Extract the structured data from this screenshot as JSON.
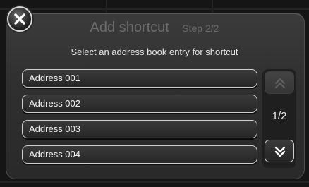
{
  "dialog": {
    "title": "Add shortcut",
    "step": "Step 2/2",
    "instruction": "Select an address book entry for shortcut",
    "close_icon": "close-icon"
  },
  "entries": [
    {
      "label": "Address 001"
    },
    {
      "label": "Address 002"
    },
    {
      "label": "Address 003"
    },
    {
      "label": "Address 004"
    }
  ],
  "pagination": {
    "page_indicator": "1/2",
    "scroll_up_icon": "double-chevron-up-icon",
    "scroll_down_icon": "double-chevron-down-icon",
    "scroll_up_enabled": false,
    "scroll_down_enabled": true
  }
}
